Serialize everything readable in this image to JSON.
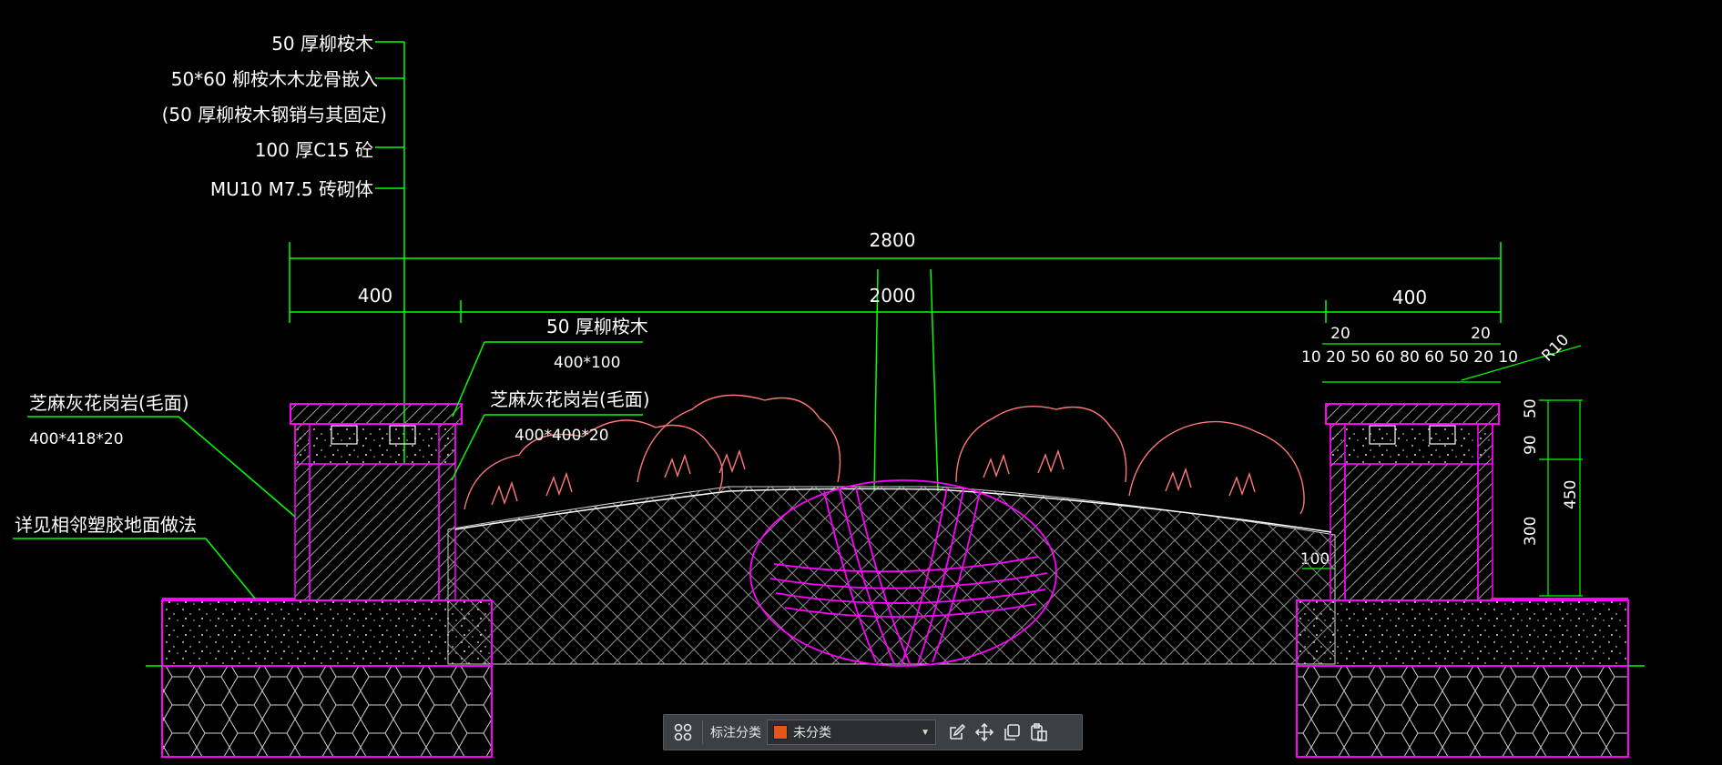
{
  "drawing": {
    "layer_labels": [
      "50 厚柳桉木",
      "50*60   柳桉木木龙骨嵌入",
      "(50 厚柳桉木钢销与其固定)",
      "100  厚C15  砼",
      "MU10 M7.5      砖砌体"
    ],
    "dimensions": {
      "overall": "2800",
      "left": "400",
      "center": "2000",
      "right": "400",
      "right_top_a": "20",
      "right_top_b": "20",
      "right_row": "10 20 50 60  80 60 50 20 10",
      "radius": "R10",
      "h_50": "50",
      "h_90": "90",
      "h_450": "450",
      "h_300": "300",
      "offset_100": "100"
    },
    "callouts": {
      "left_stone": "芝麻灰花岗岩(毛面)",
      "left_stone_size": "400*418*20",
      "left_floor": "详见相邻塑胶地面做法",
      "wood_top": "50 厚柳桉木",
      "wood_size": "400*100",
      "mid_stone": "芝麻灰花岗岩(毛面)",
      "mid_stone_size": "400*400*20"
    },
    "colors": {
      "dimension": "#00ff00",
      "structure": "#ff00ff",
      "plant": "#ff6666",
      "text": "#ffffff",
      "background": "#000000"
    }
  },
  "toolbar": {
    "label": "标注分类",
    "selected_category": "未分类",
    "category_color": "#e0561b",
    "icons": [
      "grid-icon",
      "edit-icon",
      "move-icon",
      "copy-icon",
      "paste-icon"
    ]
  }
}
